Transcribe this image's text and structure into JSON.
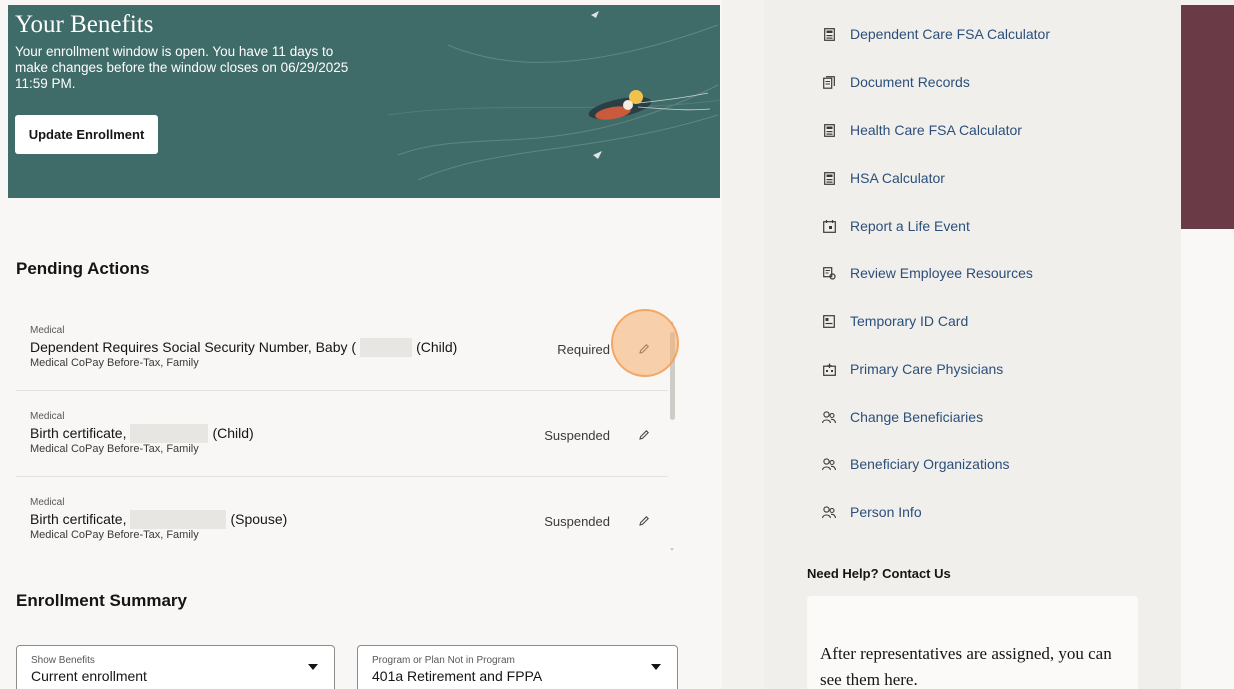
{
  "hero": {
    "title": "Your Benefits",
    "message": "Your enrollment window is open. You have 11 days to make changes before the window closes on 06/29/2025 11:59 PM.",
    "button_label": "Update Enrollment",
    "background_color": "#3f6b68"
  },
  "pending": {
    "title": "Pending Actions",
    "items": [
      {
        "category": "Medical",
        "title_prefix": "Dependent Requires Social Security Number, Baby (",
        "title_suffix": "(Child)",
        "plan": "Medical CoPay Before-Tax, Family",
        "status": "Required",
        "icon": "pencil-icon"
      },
      {
        "category": "Medical",
        "title_prefix": "Birth certificate,",
        "title_suffix": "(Child)",
        "plan": "Medical CoPay Before-Tax, Family",
        "status": "Suspended",
        "icon": "pencil-icon"
      },
      {
        "category": "Medical",
        "title_prefix": "Birth certificate,",
        "title_suffix": "(Spouse)",
        "plan": "Medical CoPay Before-Tax, Family",
        "status": "Suspended",
        "icon": "pencil-icon"
      }
    ]
  },
  "summary": {
    "title": "Enrollment Summary",
    "show_benefits": {
      "label": "Show Benefits",
      "value": "Current enrollment"
    },
    "program": {
      "label": "Program or Plan Not in Program",
      "value": "401a Retirement and FPPA"
    }
  },
  "quick_links": [
    {
      "label": "Dependent Care FSA Calculator",
      "icon": "calculator-icon"
    },
    {
      "label": "Document Records",
      "icon": "document-icon"
    },
    {
      "label": "Health Care FSA Calculator",
      "icon": "calculator-icon"
    },
    {
      "label": "HSA Calculator",
      "icon": "calculator-icon"
    },
    {
      "label": "Report a Life Event",
      "icon": "calendar-icon"
    },
    {
      "label": "Review Employee Resources",
      "icon": "resources-icon"
    },
    {
      "label": "Temporary ID Card",
      "icon": "id-card-icon"
    },
    {
      "label": "Primary Care Physicians",
      "icon": "hospital-icon"
    },
    {
      "label": "Change Beneficiaries",
      "icon": "people-icon"
    },
    {
      "label": "Beneficiary Organizations",
      "icon": "people-icon"
    },
    {
      "label": "Person Info",
      "icon": "people-icon"
    }
  ],
  "help": {
    "title": "Need Help? Contact Us",
    "text": "After representatives are assigned, you can see them here."
  },
  "colors": {
    "link": "#2b4f7a",
    "highlight": "#f6af6e",
    "maroon": "#6b3a47"
  }
}
